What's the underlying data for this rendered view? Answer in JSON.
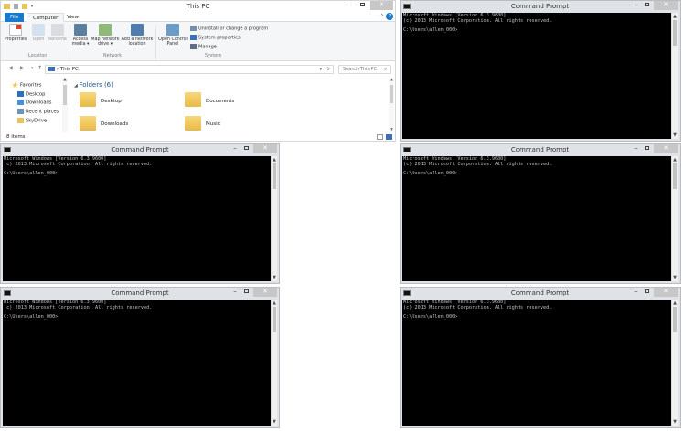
{
  "explorer": {
    "title": "This PC",
    "tabs": [
      "File",
      "Computer",
      "View"
    ],
    "ribbon": {
      "location": {
        "group": "Location",
        "buttons": [
          "Properties",
          "Open",
          "Rename"
        ]
      },
      "network": {
        "group": "Network",
        "buttons": [
          "Access media ▾",
          "Map network drive ▾",
          "Add a network location"
        ]
      },
      "system": {
        "group": "System",
        "open_control_panel": "Open Control Panel",
        "items": [
          "Uninstall or change a program",
          "System properties",
          "Manage"
        ]
      }
    },
    "address": "This PC",
    "search_placeholder": "Search This PC",
    "nav": [
      "Favorites",
      "Desktop",
      "Downloads",
      "Recent places",
      "SkyDrive"
    ],
    "section": "Folders (6)",
    "folders": [
      "Desktop",
      "Documents",
      "Downloads",
      "Music"
    ],
    "status": "8 items",
    "colors": {
      "accent": "#1979ca"
    }
  },
  "cmd": {
    "title": "Command Prompt",
    "line1": "Microsoft Windows [Version 6.3.9600]",
    "line2": "(c) 2013 Microsoft Corporation. All rights reserved.",
    "prompt": "C:\\Users\\allen_000>"
  },
  "window_controls": {
    "minimize": "–",
    "maximize": "□",
    "close": "✕"
  }
}
